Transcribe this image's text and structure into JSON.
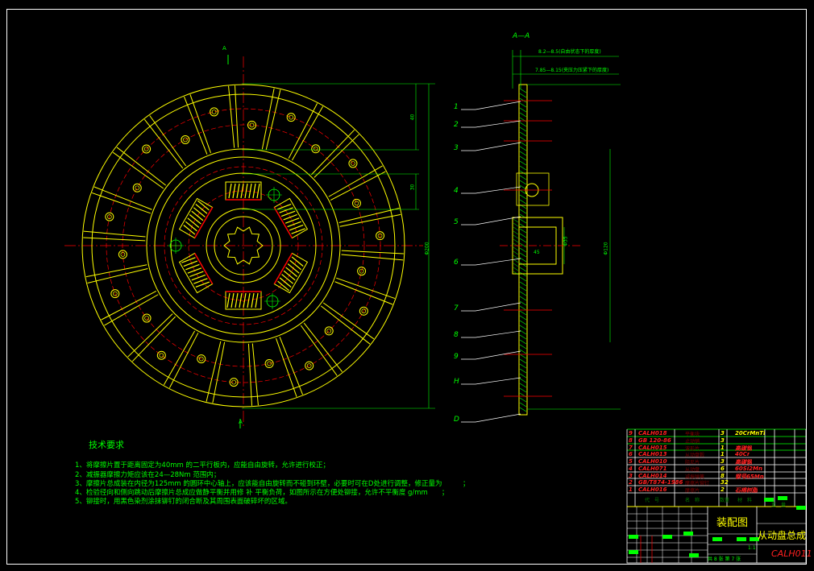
{
  "section_title": "A—A",
  "section_mark": "A",
  "dims": {
    "top1": "8.2—8.5(自由状态下的厚度)",
    "top2": "7.85—8.15(夹压力压紧下的厚度)",
    "d40": "40",
    "d30": "30",
    "dia_main": "Φ200",
    "dia_side": "Φ120",
    "d35": "Φ35",
    "d45": "45"
  },
  "callouts": [
    "1",
    "2",
    "3",
    "4",
    "5",
    "6",
    "7",
    "8",
    "9",
    "H",
    "D"
  ],
  "requirements": {
    "title": "技术要求",
    "items": [
      "1、将摩擦片置于距离固定为40mm 的二平行板内，应能自由旋转，允许进行校正；",
      "2、减振器摩擦力矩应该在24—28Nm 范围内；",
      "3、摩擦片总成装在内径为125mm 的圆环中心轴上，应该能自由旋转而不碰到环壁，必要时可在D处进行调整，修正量为　　　；",
      "4、检验径向和侧向跳动后摩擦片总成应做静平衡并用修 补 平衡负荷，如图所示在方便处铆接，允许不平衡度 g/mm　　；",
      "5、铆接时，用黑色染剂涂抹铆钉的闭合断及其周围表面破碎坏的区域。"
    ]
  },
  "parts": [
    {
      "no": "9",
      "code": "CALH018",
      "name": "平衡块",
      "qty": "3",
      "material": "20CrMnTi"
    },
    {
      "no": "8",
      "code": "GB 120-86",
      "name": "止动销",
      "qty": "3",
      "material": ""
    },
    {
      "no": "7",
      "code": "CALH015",
      "name": "波形片",
      "qty": "1",
      "material": "高碳钢"
    },
    {
      "no": "6",
      "code": "CALH013",
      "name": "从动盘毂",
      "qty": "1",
      "material": "40Cr"
    },
    {
      "no": "5",
      "code": "CALH010",
      "name": "阻尼片",
      "qty": "3",
      "material": "高碳钢"
    },
    {
      "no": "4",
      "code": "CALH071",
      "name": "从动盘",
      "qty": "6",
      "material": "60Si2Mn"
    },
    {
      "no": "3",
      "code": "CALH014",
      "name": "减振弹簧",
      "qty": "8",
      "material": "钢号65Mn"
    },
    {
      "no": "2",
      "code": "GB/T874-1986",
      "name": "摩擦片铆钉",
      "qty": "32",
      "material": ""
    },
    {
      "no": "1",
      "code": "CALH016",
      "name": "摩擦片",
      "qty": "2",
      "material": "石棉树脂"
    }
  ],
  "parts_header": {
    "code": "代　号",
    "name": "名　称",
    "qty": "数量",
    "material": "材　料",
    "weight": "重　量"
  },
  "title_block": {
    "drawing_type": "装配图",
    "part_name": "从动盘总成",
    "drawing_no": "CALH011",
    "scale": "1:1",
    "sheets": "共 8 张  第 7 张"
  },
  "colors": {
    "outline": "#ffff00",
    "center": "#ff0000",
    "dim": "#00ff00",
    "frame": "#ffffff"
  }
}
